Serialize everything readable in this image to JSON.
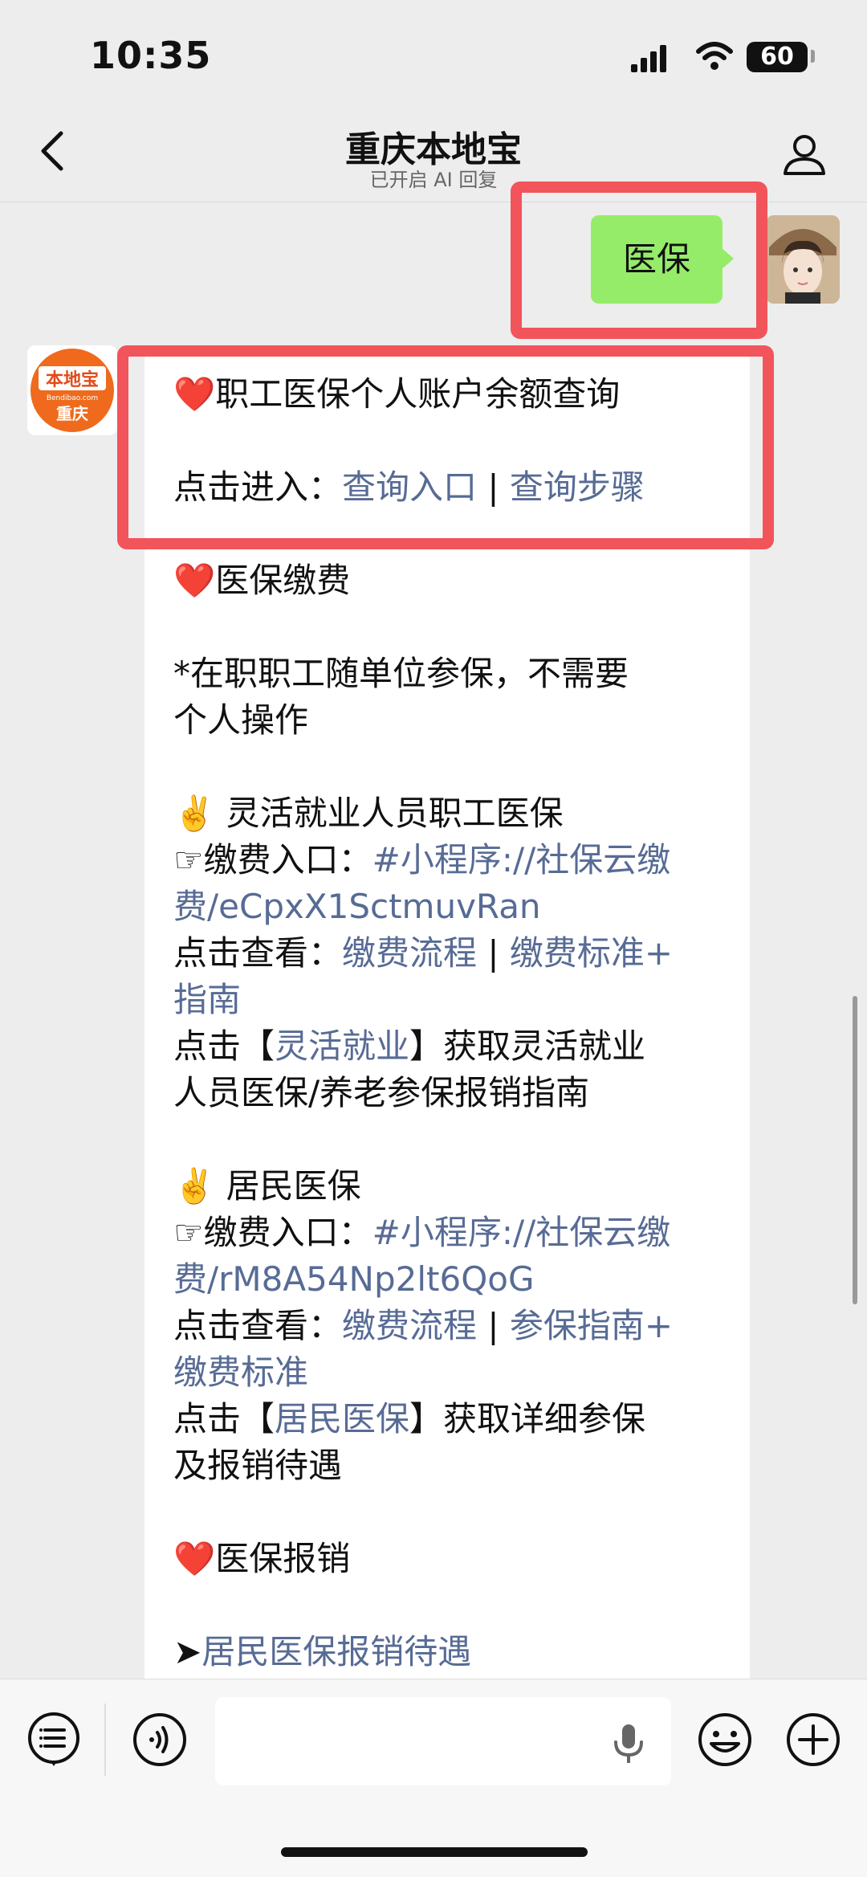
{
  "status_bar": {
    "time": "10:35",
    "battery": "60"
  },
  "nav": {
    "title": "重庆本地宝",
    "subtitle": "已开启 AI 回复"
  },
  "user_message": {
    "text": "医保"
  },
  "bot_avatar": {
    "top_text": "本地宝",
    "mid_text": "Bendibao.com",
    "bottom_text": "重庆"
  },
  "bot_message": {
    "s1_heading": "❤️职工医保个人账户余额查询",
    "s1_prefix": "点击进入：",
    "s1_link1": "查询入口",
    "s1_sep": " | ",
    "s1_link2": "查询步骤",
    "s2_heading": "❤️医保缴费",
    "s2_note_line1": "*在职职工随单位参保，不需要",
    "s2_note_line2": "个人操作",
    "flex_heading": "✌️ 灵活就业人员职工医保",
    "flex_pay_prefix": "☞缴费入口：",
    "flex_pay_link_line1": "#小程序://社保云缴",
    "flex_pay_link_line2": "费/eCpxX1SctmuvRan",
    "flex_view_prefix": "点击查看：",
    "flex_view_link1": "缴费流程",
    "flex_view_sep": " | ",
    "flex_view_link2_line1": "缴费标准+",
    "flex_view_link2_line2": "指南",
    "flex_click_prefix": "点击【",
    "flex_click_link": "灵活就业",
    "flex_click_suffix": "】获取灵活就业",
    "flex_click_line2": "人员医保/养老参保报销指南",
    "res_heading": "✌️ 居民医保",
    "res_pay_prefix": "☞缴费入口：",
    "res_pay_link_line1": "#小程序://社保云缴",
    "res_pay_link_line2": "费/rM8A54Np2lt6QoG",
    "res_view_prefix": "点击查看：",
    "res_view_link1": "缴费流程",
    "res_view_sep": " | ",
    "res_view_link2_line1": "参保指南+",
    "res_view_link2_line2": "缴费标准",
    "res_click_prefix": "点击【",
    "res_click_link": "居民医保",
    "res_click_suffix": "】获取详细参保",
    "res_click_line2": "及报销待遇",
    "s3_heading": "❤️医保报销",
    "s3_arrow": "➤",
    "s3_link": "居民医保报销待遇"
  },
  "colors": {
    "link": "#576b95",
    "bubble_green": "#95ec69",
    "highlight_red": "#f2545b"
  },
  "toolbar": {
    "icons": [
      "menu-list-icon",
      "voice-icon",
      "microphone-icon",
      "emoji-icon",
      "plus-icon"
    ]
  }
}
